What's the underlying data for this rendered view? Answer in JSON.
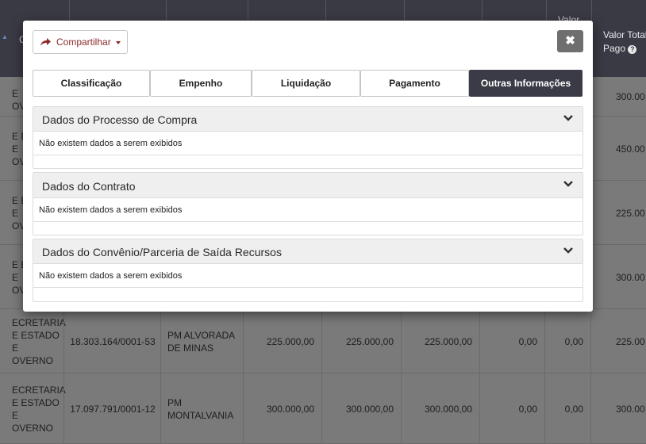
{
  "table": {
    "header": {
      "first_col_initial": "C",
      "valor_partial": "Valor",
      "valor_total_pago": "Valor Total Pago",
      "help_icon": "question-circle-icon"
    },
    "rows": [
      {
        "orgao": [
          "E",
          "OV"
        ],
        "cnpj": "",
        "favorecido": [],
        "v1": "",
        "v2": "",
        "v3": "",
        "v4": "",
        "v5": "",
        "total": "300.00"
      },
      {
        "orgao": [
          "E E",
          "E",
          "OV"
        ],
        "cnpj": "",
        "favorecido": [],
        "v1": "",
        "v2": "",
        "v3": "",
        "v4": "",
        "v5": "",
        "total": "450.00"
      },
      {
        "orgao": [
          "E E",
          "E",
          "OV"
        ],
        "cnpj": "",
        "favorecido": [],
        "v1": "",
        "v2": "",
        "v3": "",
        "v4": "",
        "v5": "",
        "total": "225.00"
      },
      {
        "orgao": [
          "E E",
          "E",
          "OV"
        ],
        "cnpj": "",
        "favorecido": [],
        "v1": "",
        "v2": "",
        "v3": "",
        "v4": "",
        "v5": "",
        "total": "300.00"
      },
      {
        "orgao": [
          "ECRETARIA",
          "E ESTADO",
          "E",
          "OVERNO"
        ],
        "cnpj": "18.303.164/0001-53",
        "favorecido": [
          "PM ALVORADA",
          "DE MINAS"
        ],
        "v1": "225.000,00",
        "v2": "225.000,00",
        "v3": "225.000,00",
        "v4": "0,00",
        "v5": "0,00",
        "total": "225.00"
      },
      {
        "orgao": [
          "ECRETARIA",
          "E ESTADO",
          "E",
          "OVERNO"
        ],
        "cnpj": "17.097.791/0001-12",
        "favorecido": [
          "PM",
          "MONTALVANIA"
        ],
        "v1": "300.000,00",
        "v2": "300.000,00",
        "v3": "300.000,00",
        "v4": "0,00",
        "v5": "0,00",
        "total": "300.00"
      }
    ]
  },
  "modal": {
    "share": {
      "label": "Compartilhar",
      "icon": "share-arrow-icon",
      "caret": "caret-down-icon"
    },
    "close": {
      "label": "✖",
      "icon": "close-icon"
    },
    "tabs": [
      {
        "label": "Classificação",
        "active": false
      },
      {
        "label": "Empenho",
        "active": false
      },
      {
        "label": "Liquidação",
        "active": false
      },
      {
        "label": "Pagamento",
        "active": false
      },
      {
        "label": "Outras Informações",
        "active": true
      }
    ],
    "panels": [
      {
        "title": "Dados do Processo de Compra",
        "empty_text": "Não existem dados a serem exibidos"
      },
      {
        "title": "Dados do Contrato",
        "empty_text": "Não existem dados a serem exibidos"
      },
      {
        "title": "Dados do Convênio/Parceria de Saída Recursos",
        "empty_text": "Não existem dados a serem exibidos"
      }
    ]
  },
  "colors": {
    "header_bg": "#3a3a44",
    "active_tab_bg": "#3b3b48",
    "share_text": "#8b2a2a",
    "close_bg": "#6f6f6f"
  }
}
